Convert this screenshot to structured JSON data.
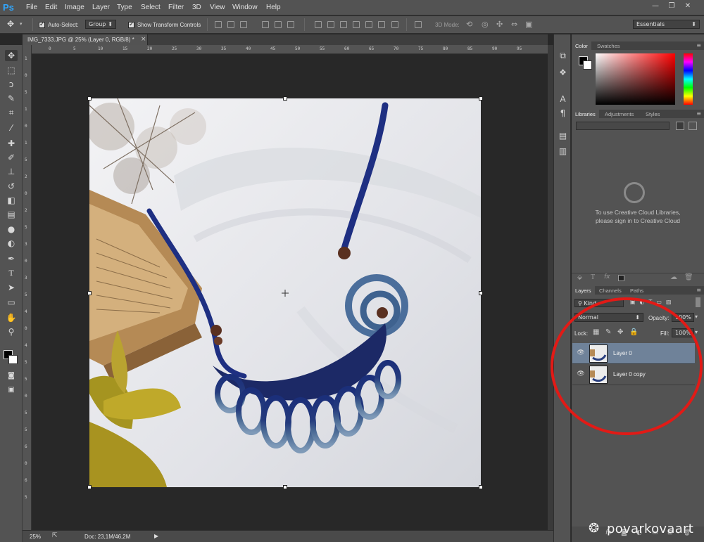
{
  "app": {
    "logo": "Ps"
  },
  "menu": [
    "File",
    "Edit",
    "Image",
    "Layer",
    "Type",
    "Select",
    "Filter",
    "3D",
    "View",
    "Window",
    "Help"
  ],
  "window_controls": {
    "minimize": "—",
    "restore": "❐",
    "close": "✕"
  },
  "options_bar": {
    "auto_select_label": "Auto-Select:",
    "auto_select_value": "Group",
    "show_transform_label": "Show Transform Controls",
    "three_d_mode_label": "3D Mode:",
    "workspace": "Essentials"
  },
  "document": {
    "tab_title": "IMG_7333.JPG @ 25% (Layer 0, RGB/8) *",
    "close": "×"
  },
  "rulers": {
    "top": [
      "5",
      "0",
      "5",
      "10",
      "15",
      "20",
      "25",
      "30",
      "35",
      "40",
      "45",
      "50",
      "55",
      "60",
      "65",
      "70",
      "75",
      "80",
      "85",
      "90",
      "95"
    ],
    "left": [
      "1",
      "0",
      "5",
      "1",
      "0",
      "1",
      "5",
      "2",
      "0",
      "2",
      "5",
      "3",
      "0",
      "3",
      "5",
      "4",
      "0",
      "4",
      "5",
      "5",
      "0",
      "5",
      "5",
      "6",
      "0",
      "6",
      "5"
    ]
  },
  "status_bar": {
    "zoom": "25%",
    "doc_info": "Doc: 23,1M/46,2M"
  },
  "panels": {
    "color_tabs": [
      "Color",
      "Swatches"
    ],
    "libraries_tabs": [
      "Libraries",
      "Adjustments",
      "Styles"
    ],
    "libraries_message": [
      "To use Creative Cloud Libraries,",
      "please sign in to Creative Cloud"
    ],
    "layers_tabs": [
      "Layers",
      "Channels",
      "Paths"
    ],
    "kind_filter": "Kind",
    "blend_mode": "Normal",
    "opacity_label": "Opacity:",
    "opacity_value": "100%",
    "lock_label": "Lock:",
    "fill_label": "Fill:",
    "fill_value": "100%",
    "layers": [
      {
        "name": "Layer 0",
        "selected": true
      },
      {
        "name": "Layer 0 copy",
        "selected": false
      }
    ]
  },
  "watermark": "povarkovaart",
  "colors": {
    "accent": "#31a8ff",
    "selection": "#6f8299",
    "annotation": "#e21a16"
  }
}
